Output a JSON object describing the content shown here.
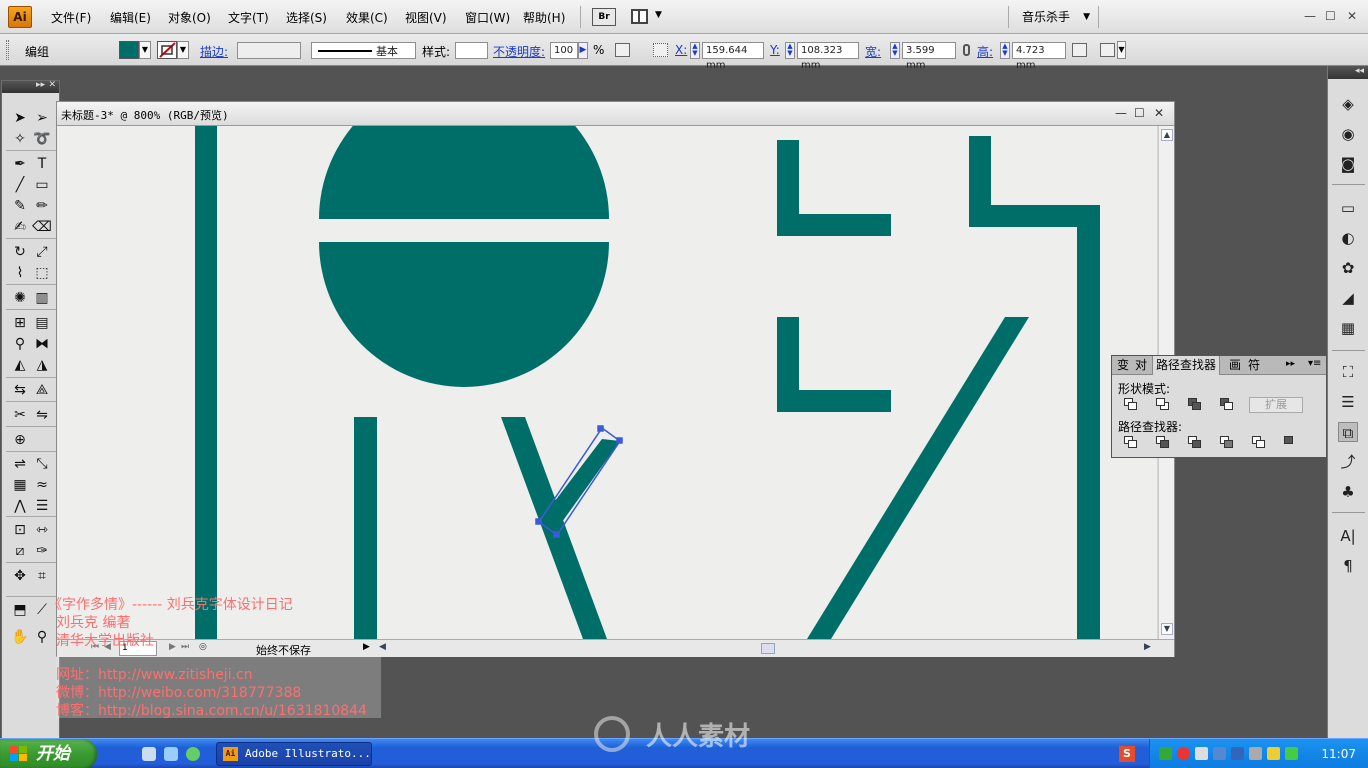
{
  "app": {
    "logo_text": "Ai",
    "menus": [
      "文件(F)",
      "编辑(E)",
      "对象(O)",
      "文字(T)",
      "选择(S)",
      "效果(C)",
      "视图(V)",
      "窗口(W)",
      "帮助(H)"
    ],
    "bridge_label": "Br",
    "workspace": "音乐杀手",
    "window_controls": {
      "minimize": "—",
      "maximize": "☐",
      "close": "✕"
    }
  },
  "control_bar": {
    "selection_type": "编组",
    "fill_color": "#006e68",
    "stroke_label": "描边:",
    "stroke_style": "基本",
    "style_label": "样式:",
    "opacity_label": "不透明度:",
    "opacity_value": "100",
    "opacity_unit": "%",
    "x_label": "X:",
    "x_value": "159.644 mm",
    "y_label": "Y:",
    "y_value": "108.323 mm",
    "w_label": "宽:",
    "w_value": "3.599 mm",
    "h_label": "高:",
    "h_value": "4.723 mm"
  },
  "tools": {
    "rows": [
      [
        "selection-tool",
        "direct-selection-tool"
      ],
      [
        "magic-wand-tool",
        "lasso-tool"
      ],
      [
        "pen-tool",
        "type-tool"
      ],
      [
        "line-segment-tool",
        "rectangle-tool"
      ],
      [
        "paintbrush-tool",
        "pencil-tool"
      ],
      [
        "blob-brush-tool",
        "eraser-tool"
      ],
      [
        "rotate-tool",
        "scale-tool"
      ],
      [
        "warp-tool",
        "free-transform-tool"
      ],
      [
        "symbol-sprayer-tool",
        "column-graph-tool"
      ],
      [
        "mesh-tool",
        "gradient-tool"
      ],
      [
        "eyedropper-tool",
        "blend-tool"
      ],
      [
        "live-paint-bucket-tool",
        "live-paint-selection-tool"
      ],
      [
        "artboard-tool",
        "slice-tool"
      ],
      [
        "hand-tool",
        "zoom-tool"
      ]
    ]
  },
  "document": {
    "title": "未标题-3* @ 800% (RGB/预览)",
    "zoom": "800%",
    "page": "1",
    "status": "始终不保存",
    "shape_color": "#006e68",
    "selection_color": "#3b5bd9"
  },
  "pathfinder": {
    "tabs": [
      "变",
      "对",
      "路径查找器",
      "画",
      "符"
    ],
    "active_tab": "路径查找器",
    "shape_modes_label": "形状模式:",
    "expand_label": "扩展",
    "pathfinders_label": "路径查找器:"
  },
  "credits": {
    "line1": "《字作多情》------ 刘兵克字体设计日记",
    "line2": "刘兵克  编著",
    "line3": "清华大学出版社",
    "line4": "网址：http://www.zitisheji.cn",
    "line5": "微博：http://weibo.com/318777388",
    "line6": "博客：http://blog.sina.com.cn/u/1631810844"
  },
  "taskbar": {
    "start_label": "开始",
    "task_label": "Adobe Illustrato...",
    "tray_time": "11:07",
    "watermark": "人人素材"
  }
}
